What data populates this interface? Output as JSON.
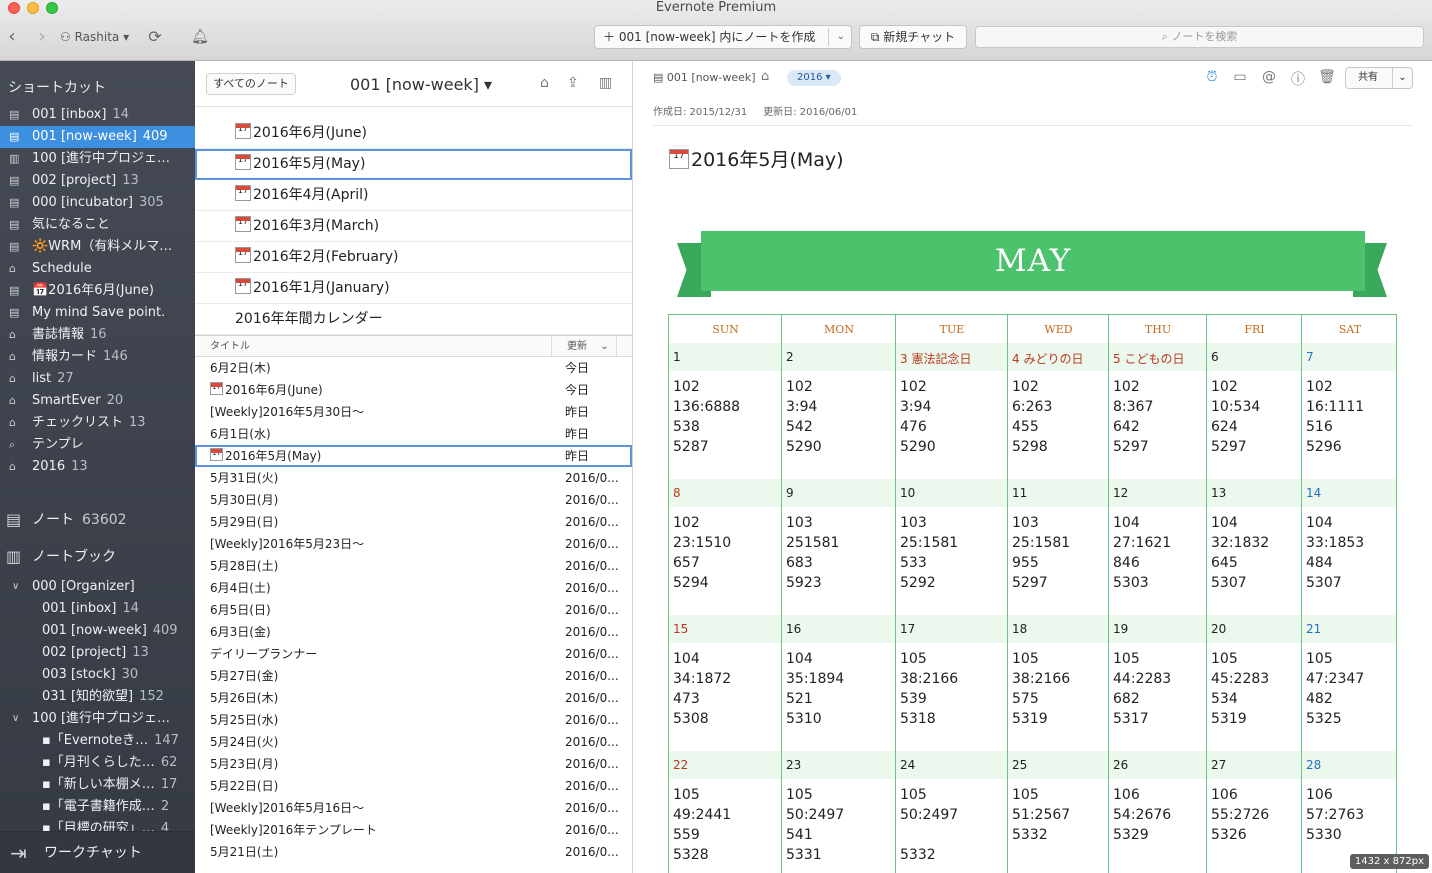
{
  "window": {
    "title": "Evernote Premium"
  },
  "toolbar": {
    "user": "Rashita ▾",
    "new_note_label": "001 [now-week] 内にノートを作成",
    "chat_label": "新規チャット",
    "search_placeholder": "ノートを検索"
  },
  "sidebar": {
    "shortcuts_header": "ショートカット",
    "shortcuts": [
      {
        "icon": "notebook-icon",
        "label": "001 [inbox]",
        "count": "14"
      },
      {
        "icon": "notebook-icon",
        "label": "001 [now-week]",
        "count": "409",
        "selected": true
      },
      {
        "icon": "stack-icon",
        "label": "100 [進行中プロジェ…",
        "count": ""
      },
      {
        "icon": "notebook-icon",
        "label": "002 [project]",
        "count": "13"
      },
      {
        "icon": "notebook-icon",
        "label": "000 [incubator]",
        "count": "305"
      },
      {
        "icon": "notebook-icon",
        "label": "気になること",
        "count": ""
      },
      {
        "icon": "note-icon",
        "label": "🔆WRM（有料メルマ…",
        "count": ""
      },
      {
        "icon": "tag-icon",
        "label": "Schedule",
        "count": ""
      },
      {
        "icon": "note-icon",
        "label": "📅2016年6月(June)",
        "count": ""
      },
      {
        "icon": "note-icon",
        "label": "My mind Save point.",
        "count": ""
      },
      {
        "icon": "tag-icon",
        "label": "書誌情報",
        "count": "16"
      },
      {
        "icon": "tag-icon",
        "label": "情報カード",
        "count": "146"
      },
      {
        "icon": "tag-icon",
        "label": "list",
        "count": "27"
      },
      {
        "icon": "tag-icon",
        "label": "SmartEver",
        "count": "20"
      },
      {
        "icon": "tag-icon",
        "label": "チェックリスト",
        "count": "13"
      },
      {
        "icon": "search-icon",
        "label": "テンプレ",
        "count": ""
      },
      {
        "icon": "tag-icon",
        "label": "2016",
        "count": "13"
      }
    ],
    "notes_label": "ノート",
    "notes_count": "63602",
    "notebooks_label": "ノートブック",
    "notebooks": [
      {
        "label": "000 [Organizer]",
        "count": "",
        "indent": 1,
        "toggle": "⌄"
      },
      {
        "label": "001 [inbox]",
        "count": "14",
        "indent": 2,
        "toggle": ""
      },
      {
        "label": "001 [now-week]",
        "count": "409",
        "indent": 2,
        "toggle": ""
      },
      {
        "label": "002 [project]",
        "count": "13",
        "indent": 2,
        "toggle": ""
      },
      {
        "label": "003 [stock]",
        "count": "30",
        "indent": 2,
        "toggle": ""
      },
      {
        "label": "031 [知的欲望]",
        "count": "152",
        "indent": 2,
        "toggle": ""
      },
      {
        "label": "100 [進行中プロジェ…",
        "count": "",
        "indent": 1,
        "toggle": "⌄"
      },
      {
        "label": "▪「Evernoteき…",
        "count": "147",
        "indent": 2,
        "toggle": ""
      },
      {
        "label": "▪「月刊くらした…",
        "count": "62",
        "indent": 2,
        "toggle": ""
      },
      {
        "label": "▪「新しい本棚メ…",
        "count": "17",
        "indent": 2,
        "toggle": ""
      },
      {
        "label": "▪「電子書籍作成…",
        "count": "2",
        "indent": 2,
        "toggle": ""
      },
      {
        "label": "▪「目標の研究」…",
        "count": "4",
        "indent": 2,
        "toggle": ""
      }
    ],
    "workchat_label": "ワークチャット"
  },
  "notelist": {
    "all_notes_label": "すべてのノート",
    "title": "001 [now-week] ▾",
    "cards": [
      {
        "cal": true,
        "label": "2016年6月(June)",
        "selected": false
      },
      {
        "cal": true,
        "label": "2016年5月(May)",
        "selected": true
      },
      {
        "cal": true,
        "label": "2016年4月(April)",
        "selected": false
      },
      {
        "cal": true,
        "label": "2016年3月(March)",
        "selected": false
      },
      {
        "cal": true,
        "label": "2016年2月(February)",
        "selected": false
      },
      {
        "cal": true,
        "label": "2016年1月(January)",
        "selected": false
      },
      {
        "cal": false,
        "label": "2016年年間カレンダー",
        "selected": false
      }
    ],
    "col_title": "タイトル",
    "col_updated": "更新",
    "rows": [
      {
        "title": "6月2日(木)",
        "updated": "今日",
        "cal": false
      },
      {
        "title": "2016年6月(June)",
        "updated": "今日",
        "cal": true
      },
      {
        "title": "[Weekly]2016年5月30日〜",
        "updated": "昨日",
        "cal": false
      },
      {
        "title": "6月1日(水)",
        "updated": "昨日",
        "cal": false
      },
      {
        "title": "2016年5月(May)",
        "updated": "昨日",
        "cal": true,
        "selected": true
      },
      {
        "title": "5月31日(火)",
        "updated": "2016/0...",
        "cal": false
      },
      {
        "title": "5月30日(月)",
        "updated": "2016/0...",
        "cal": false
      },
      {
        "title": "5月29日(日)",
        "updated": "2016/0...",
        "cal": false
      },
      {
        "title": "[Weekly]2016年5月23日〜",
        "updated": "2016/0...",
        "cal": false
      },
      {
        "title": "5月28日(土)",
        "updated": "2016/0...",
        "cal": false
      },
      {
        "title": "6月4日(土)",
        "updated": "2016/0...",
        "cal": false
      },
      {
        "title": "6月5日(日)",
        "updated": "2016/0...",
        "cal": false
      },
      {
        "title": "6月3日(金)",
        "updated": "2016/0...",
        "cal": false
      },
      {
        "title": "デイリープランナー",
        "updated": "2016/0...",
        "cal": false
      },
      {
        "title": "5月27日(金)",
        "updated": "2016/0...",
        "cal": false
      },
      {
        "title": "5月26日(木)",
        "updated": "2016/0...",
        "cal": false
      },
      {
        "title": "5月25日(水)",
        "updated": "2016/0...",
        "cal": false
      },
      {
        "title": "5月24日(火)",
        "updated": "2016/0...",
        "cal": false
      },
      {
        "title": "5月23日(月)",
        "updated": "2016/0...",
        "cal": false
      },
      {
        "title": "5月22日(日)",
        "updated": "2016/0...",
        "cal": false
      },
      {
        "title": "[Weekly]2016年5月16日〜",
        "updated": "2016/0...",
        "cal": false
      },
      {
        "title": "[Weekly]2016年テンプレート",
        "updated": "2016/0...",
        "cal": false
      },
      {
        "title": "5月21日(土)",
        "updated": "2016/0...",
        "cal": false
      }
    ]
  },
  "note": {
    "notebook": "001 [now-week]",
    "tag": "2016 ▾",
    "created": "作成日: 2015/12/31",
    "updated": "更新日: 2016/06/01",
    "share_label": "共有",
    "title": "2016年5月(May)",
    "banner": "MAY",
    "days_of_week": [
      "SUN",
      "MON",
      "TUE",
      "WED",
      "THU",
      "FRI",
      "SAT"
    ],
    "weeks": [
      [
        {
          "day": "1",
          "kind": "",
          "vals": [
            "102",
            "136:6888",
            "538",
            "5287"
          ]
        },
        {
          "day": "2",
          "kind": "",
          "vals": [
            "102",
            "3:94",
            "542",
            "5290"
          ]
        },
        {
          "day": "3 憲法記念日",
          "kind": "hol",
          "vals": [
            "102",
            "3:94",
            "476",
            "5290"
          ]
        },
        {
          "day": "4 みどりの日",
          "kind": "hol",
          "vals": [
            "102",
            "6:263",
            "455",
            "5298"
          ]
        },
        {
          "day": "5 こどもの日",
          "kind": "hol",
          "vals": [
            "102",
            "8:367",
            "642",
            "5297"
          ]
        },
        {
          "day": "6",
          "kind": "",
          "vals": [
            "102",
            "10:534",
            "624",
            "5297"
          ]
        },
        {
          "day": "7",
          "kind": "sat",
          "vals": [
            "102",
            "16:1111",
            "516",
            "5296"
          ]
        }
      ],
      [
        {
          "day": "8",
          "kind": "sun",
          "vals": [
            "102",
            "23:1510",
            "657",
            "5294"
          ]
        },
        {
          "day": "9",
          "kind": "",
          "vals": [
            "103",
            "251581",
            "683",
            "5923"
          ]
        },
        {
          "day": "10",
          "kind": "",
          "vals": [
            "103",
            "25:1581",
            "533",
            "5292"
          ]
        },
        {
          "day": "11",
          "kind": "",
          "vals": [
            "103",
            "25:1581",
            "955",
            "5297"
          ]
        },
        {
          "day": "12",
          "kind": "",
          "vals": [
            "104",
            "27:1621",
            "846",
            "5303"
          ]
        },
        {
          "day": "13",
          "kind": "",
          "vals": [
            "104",
            "32:1832",
            "645",
            "5307"
          ]
        },
        {
          "day": "14",
          "kind": "sat",
          "vals": [
            "104",
            "33:1853",
            "484",
            "5307"
          ]
        }
      ],
      [
        {
          "day": "15",
          "kind": "sun",
          "vals": [
            "104",
            "34:1872",
            "473",
            "5308"
          ]
        },
        {
          "day": "16",
          "kind": "",
          "vals": [
            "104",
            "35:1894",
            "521",
            "5310"
          ]
        },
        {
          "day": "17",
          "kind": "",
          "vals": [
            "105",
            "38:2166",
            "539",
            "5318"
          ]
        },
        {
          "day": "18",
          "kind": "",
          "vals": [
            "105",
            "38:2166",
            "575",
            "5319"
          ]
        },
        {
          "day": "19",
          "kind": "",
          "vals": [
            "105",
            "44:2283",
            "682",
            "5317"
          ]
        },
        {
          "day": "20",
          "kind": "",
          "vals": [
            "105",
            "45:2283",
            "534",
            "5319"
          ]
        },
        {
          "day": "21",
          "kind": "sat",
          "vals": [
            "105",
            "47:2347",
            "482",
            "5325"
          ]
        }
      ],
      [
        {
          "day": "22",
          "kind": "sun",
          "vals": [
            "105",
            "49:2441",
            "559",
            "5328"
          ]
        },
        {
          "day": "23",
          "kind": "",
          "vals": [
            "105",
            "50:2497",
            "541",
            "5331"
          ]
        },
        {
          "day": "24",
          "kind": "",
          "vals": [
            "105",
            "50:2497",
            "",
            "5332"
          ]
        },
        {
          "day": "25",
          "kind": "",
          "vals": [
            "105",
            "51:2567",
            "5332",
            ""
          ]
        },
        {
          "day": "26",
          "kind": "",
          "vals": [
            "106",
            "54:2676",
            "5329",
            ""
          ]
        },
        {
          "day": "27",
          "kind": "",
          "vals": [
            "106",
            "55:2726",
            "5326",
            ""
          ]
        },
        {
          "day": "28",
          "kind": "sat",
          "vals": [
            "106",
            "57:2763",
            "5330",
            ""
          ]
        }
      ]
    ]
  },
  "size_badge": "1432 x 872px",
  "colors": {
    "sidebar_bg": "#3f444e",
    "selection": "#3d8fe0",
    "ribbon": "#4cc26c",
    "calendar_border": "#6cc483",
    "sunday": "#b73b1c",
    "saturday": "#2670c2"
  }
}
